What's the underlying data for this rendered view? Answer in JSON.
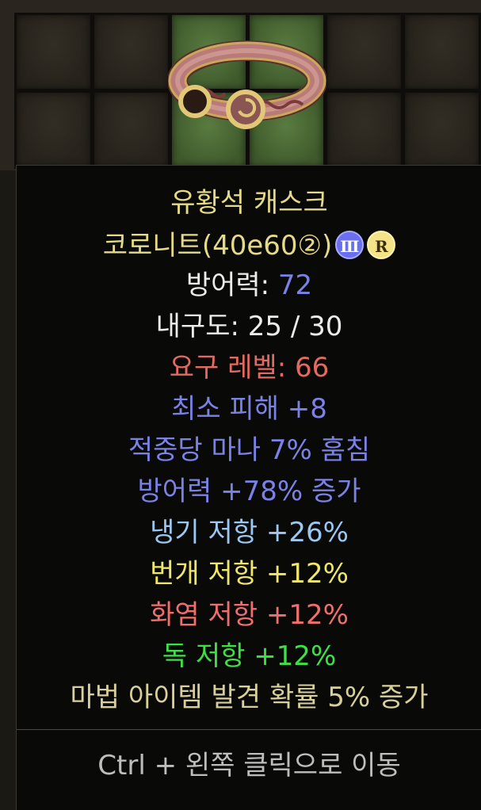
{
  "item": {
    "name_line1": "유황석 캐스크",
    "name_line2": "코로니트(40e60②)",
    "badge_tier": "Ⅲ",
    "badge_rune": "R",
    "defense_label": "방어력: ",
    "defense_value": "72",
    "durability": "내구도: 25 / 30",
    "required_level": "요구 레벨: 66",
    "affixes": [
      "최소 피해 +8",
      "적중당 마나 7% 훔침",
      "방어력 +78% 증가",
      "냉기 저항 +26%",
      "번개 저항 +12%",
      "화염 저항 +12%",
      "독 저항 +12%",
      "마법 아이템 발견 확률 5% 증가"
    ],
    "hint": "Ctrl + 왼쪽 클릭으로 이동"
  },
  "inventory": {
    "selected_slot_item": "circlet-icon"
  },
  "colors": {
    "name": "#e5da87",
    "defense_value": "#7b82e6",
    "required_level": "#e36a60",
    "magic_affix": "#7b82e6",
    "cold": "#9cc7f0",
    "lightning": "#f0e66b",
    "fire": "#f06e6e",
    "poison": "#3ee046",
    "magic_find": "#d9cf9a",
    "hint": "#bdbdbd"
  }
}
